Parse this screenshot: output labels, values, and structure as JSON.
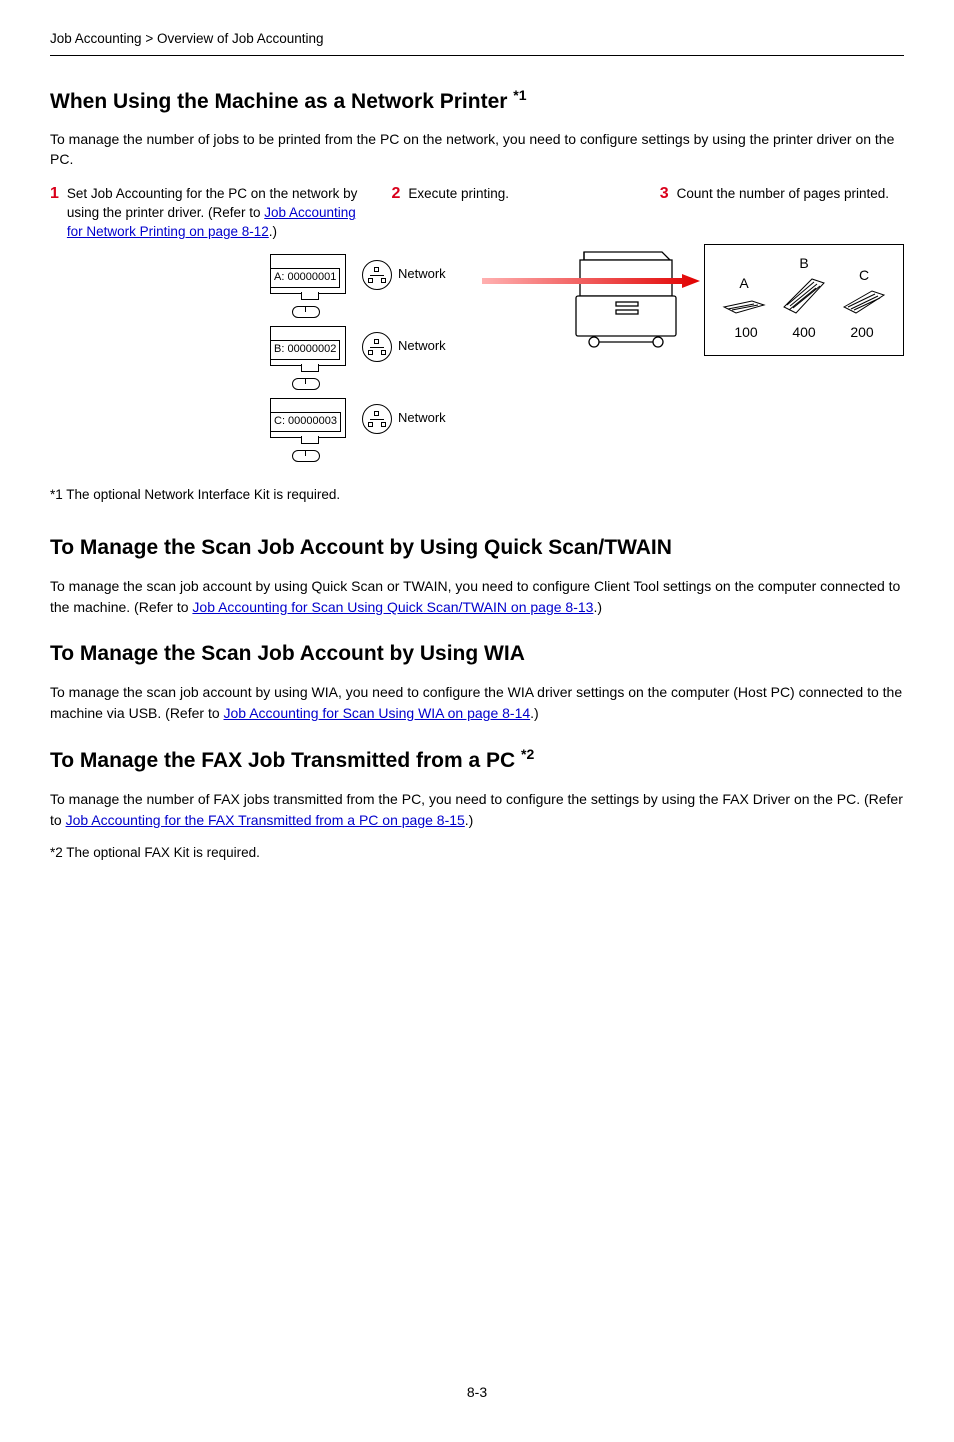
{
  "breadcrumb": "Job Accounting > Overview of Job Accounting",
  "section1": {
    "title_main": "When Using the Machine as a Network Printer ",
    "title_sup": "*1",
    "intro": "To manage the number of jobs to be printed from the PC on the network, you need to configure settings by using the printer driver on the PC.",
    "step1_num": "1",
    "step1_text1": "Set Job Accounting for the PC on the network by using the printer driver. (Refer to ",
    "step1_link": "Job Accounting for Network Printing on page 8-12",
    "step1_text2": ".)",
    "step2_num": "2",
    "step2_text": "Execute printing.",
    "step3_num": "3",
    "step3_text": "Count the number of pages printed.",
    "pc_a": "A: 00000001",
    "pc_b": "B: 00000002",
    "pc_c": "C: 00000003",
    "net_label": "Network",
    "letter_a": "A",
    "letter_b": "B",
    "letter_c": "C",
    "count_a": "100",
    "count_b": "400",
    "count_c": "200",
    "footnote": "*1   The optional Network Interface Kit is required."
  },
  "section2": {
    "title": "To Manage the Scan Job Account by Using Quick Scan/TWAIN",
    "text1": "To manage the scan job account by using Quick Scan or TWAIN, you need to configure Client Tool settings on the computer connected to the machine. (Refer to ",
    "link": "Job Accounting for Scan Using Quick Scan/TWAIN on page 8-13",
    "text2": ".)"
  },
  "section3": {
    "title": "To Manage the Scan Job Account by Using WIA",
    "text1": "To manage the scan job account by using WIA, you need to configure the WIA driver settings on the computer (Host PC) connected to the machine via USB. (Refer to ",
    "link": "Job Accounting for Scan Using WIA on page 8-14",
    "text2": ".)"
  },
  "section4": {
    "title_main": "To Manage the FAX Job Transmitted from a PC ",
    "title_sup": "*2",
    "text1": "To manage the number of FAX jobs transmitted from the PC, you need to configure the settings by using the FAX Driver on the PC. (Refer to ",
    "link": "Job Accounting for the FAX Transmitted from a PC on page 8-15",
    "text2": ".)",
    "footnote": "*2   The optional FAX Kit is required."
  },
  "page_number": "8-3",
  "chart_data": {
    "type": "bar",
    "categories": [
      "A",
      "B",
      "C"
    ],
    "values": [
      100,
      400,
      200
    ],
    "title": "",
    "xlabel": "",
    "ylabel": ""
  }
}
